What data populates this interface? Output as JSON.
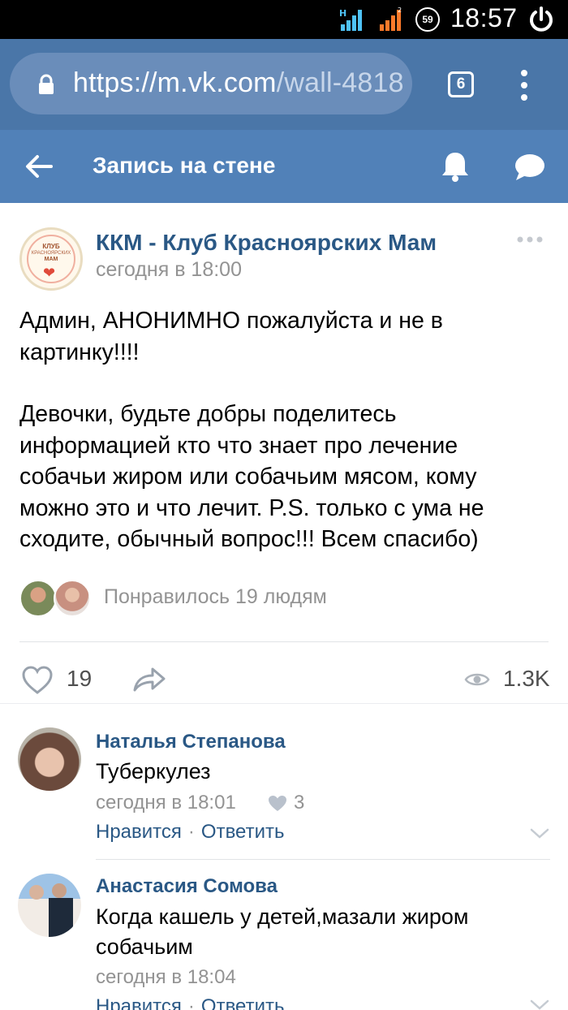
{
  "status_bar": {
    "battery": "59",
    "time": "18:57"
  },
  "browser": {
    "url_host": "https://m.vk.com",
    "url_rest": "/wall-4818",
    "tabs_count": "6"
  },
  "header": {
    "title": "Запись на стене"
  },
  "post": {
    "avatar_lines": [
      "КЛУБ",
      "КРАСНОЯРСКИХ",
      "МАМ"
    ],
    "group_name": "ККМ - Клуб Красноярских Мам",
    "date": "сегодня в 18:00",
    "text_lines_1": [
      "Админ, АНОНИМНО пожалуйста и не в",
      "картинку!!!!"
    ],
    "text_lines_2": [
      "Девочки, будьте добры поделитесь",
      "информацией кто что знает про лечение",
      "собачьи жиром или собачьим мясом, кому",
      "можно это и что лечит. P.S. только с ума не",
      "сходите, обычный вопрос!!! Всем спасибо)"
    ],
    "likes_summary": "Понравилось 19 людям",
    "like_count": "19",
    "views": "1.3K"
  },
  "comments": [
    {
      "author": "Наталья Степанова",
      "text_lines": [
        "Туберкулез"
      ],
      "date": "сегодня в 18:01",
      "likes": "3",
      "like_action": "Нравится",
      "reply_action": "Ответить"
    },
    {
      "author": "Анастасия Сомова",
      "text_lines": [
        "Когда кашель у детей,мазали жиром",
        "собачьим"
      ],
      "date": "сегодня в 18:04",
      "like_action": "Нравится",
      "reply_action": "Ответить"
    }
  ],
  "colors": {
    "browser_bar": "#4a76a8",
    "app_header": "#5181b8",
    "link": "#2a5885",
    "meta": "#939393"
  }
}
